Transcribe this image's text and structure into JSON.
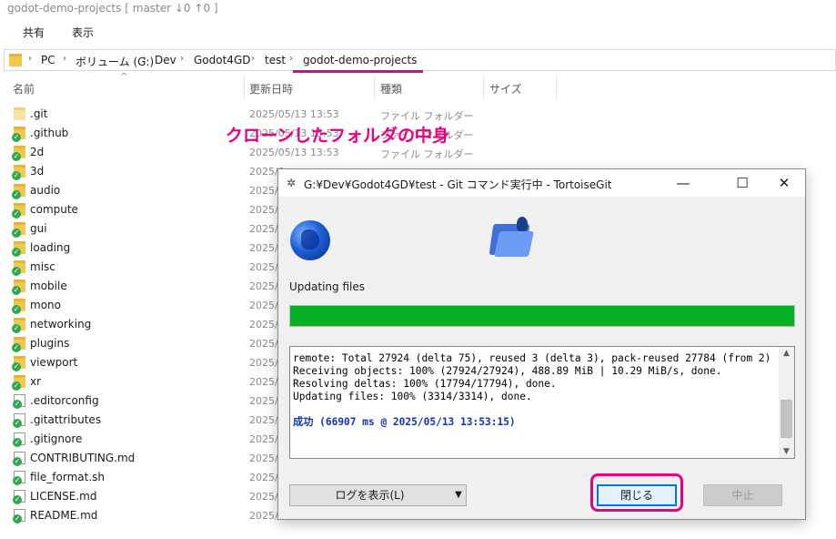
{
  "explorer": {
    "title": "godot-demo-projects [ master ↓0 ↑0 ]",
    "ribbon": {
      "share": "共有",
      "view": "表示"
    },
    "breadcrumb": [
      "PC",
      "ボリューム (G:)",
      "Dev",
      "Godot4GD",
      "test",
      "godot-demo-projects"
    ],
    "columns": {
      "name": "名前",
      "modified": "更新日時",
      "type": "種類",
      "size": "サイズ"
    },
    "files": [
      {
        "name": ".git",
        "date": "2025/05/13 13:53",
        "type": "ファイル フォルダー",
        "kind": "folder-plain"
      },
      {
        "name": ".github",
        "date": "2025/05/13 13:53",
        "type": "ファイル フォルダー",
        "kind": "folder"
      },
      {
        "name": "2d",
        "date": "2025/05/13 13:53",
        "type": "ファイル フォルダー",
        "kind": "folder"
      },
      {
        "name": "3d",
        "date": "2025/0",
        "type": "",
        "kind": "folder"
      },
      {
        "name": "audio",
        "date": "2025/0",
        "type": "",
        "kind": "folder"
      },
      {
        "name": "compute",
        "date": "2025/0",
        "type": "",
        "kind": "folder"
      },
      {
        "name": "gui",
        "date": "2025/0",
        "type": "",
        "kind": "folder"
      },
      {
        "name": "loading",
        "date": "2025/0",
        "type": "",
        "kind": "folder"
      },
      {
        "name": "misc",
        "date": "2025/0",
        "type": "",
        "kind": "folder"
      },
      {
        "name": "mobile",
        "date": "2025/0",
        "type": "",
        "kind": "folder"
      },
      {
        "name": "mono",
        "date": "2025/0",
        "type": "",
        "kind": "folder"
      },
      {
        "name": "networking",
        "date": "2025/0",
        "type": "",
        "kind": "folder"
      },
      {
        "name": "plugins",
        "date": "2025/0",
        "type": "",
        "kind": "folder"
      },
      {
        "name": "viewport",
        "date": "2025/0",
        "type": "",
        "kind": "folder"
      },
      {
        "name": "xr",
        "date": "2025/0",
        "type": "",
        "kind": "folder"
      },
      {
        "name": ".editorconfig",
        "date": "2025/0",
        "type": "",
        "kind": "file"
      },
      {
        "name": ".gitattributes",
        "date": "2025/0",
        "type": "",
        "kind": "file"
      },
      {
        "name": ".gitignore",
        "date": "2025/0",
        "type": "",
        "kind": "file"
      },
      {
        "name": "CONTRIBUTING.md",
        "date": "2025/0",
        "type": "",
        "kind": "file"
      },
      {
        "name": "file_format.sh",
        "date": "2025/0",
        "type": "",
        "kind": "file"
      },
      {
        "name": "LICENSE.md",
        "date": "2025/0",
        "type": "",
        "kind": "file"
      },
      {
        "name": "README.md",
        "date": "2025/0",
        "type": "",
        "kind": "file"
      }
    ]
  },
  "annotation": "クローンしたフォルダの中身",
  "dialog": {
    "title": "G:¥Dev¥Godot4GD¥test - Git コマンド実行中 - TortoiseGit",
    "window_controls": {
      "minimize": "—",
      "maximize": "☐",
      "close": "✕"
    },
    "status": "Updating files",
    "progress_percent": 100,
    "log_lines": [
      {
        "text": "remote: Total 27924 (delta 75), reused 3 (delta 3), pack-reused 27784 (from 2)",
        "style": "normal"
      },
      {
        "text": "Receiving objects: 100% (27924/27924), 488.89 MiB | 10.29 MiB/s, done.",
        "style": "normal"
      },
      {
        "text": "Resolving deltas: 100% (17794/17794), done.",
        "style": "normal"
      },
      {
        "text": "Updating files: 100% (3314/3314), done.",
        "style": "normal"
      },
      {
        "text": "",
        "style": "normal"
      },
      {
        "text": "成功 (66907 ms @ 2025/05/13 13:53:15)",
        "style": "success"
      }
    ],
    "buttons": {
      "show_log": "ログを表示(L)",
      "close": "閉じる",
      "abort": "中止"
    }
  },
  "colors": {
    "accent_pink": "#e4007f",
    "progress_green": "#06b025",
    "success_blue": "#1433b8"
  }
}
